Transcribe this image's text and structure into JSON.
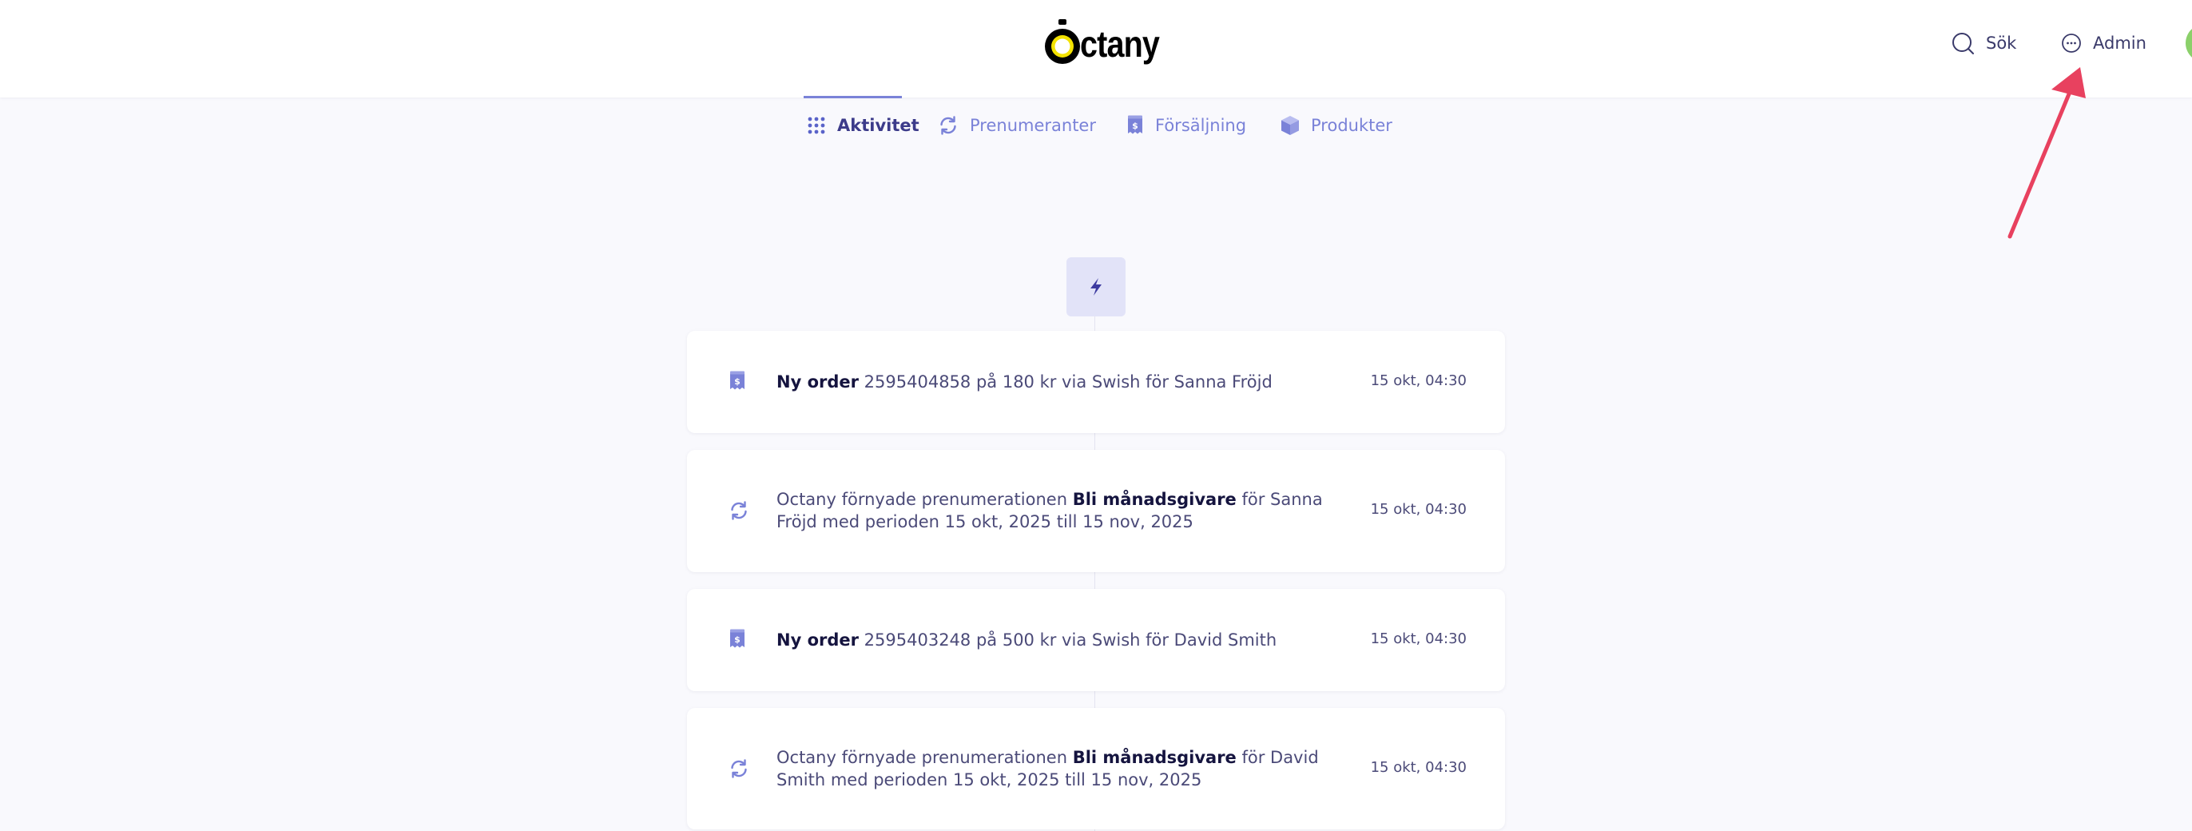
{
  "brand": {
    "name": "ctany",
    "full_name": "Octany"
  },
  "header": {
    "search_label": "Sök",
    "admin_label": "Admin"
  },
  "tabs": [
    {
      "label": "Aktivitet",
      "icon": "grid-icon",
      "active": true
    },
    {
      "label": "Prenumeranter",
      "icon": "refresh-icon",
      "active": false
    },
    {
      "label": "Försäljning",
      "icon": "receipt-icon",
      "active": false
    },
    {
      "label": "Produkter",
      "icon": "box-icon",
      "active": false
    }
  ],
  "feed": {
    "header_icon": "bolt-icon",
    "items": [
      {
        "type": "order",
        "icon": "receipt-icon",
        "prefix": "",
        "bold": "Ny order",
        "suffix": " 2595404858 på 180 kr via Swish för Sanna Fröjd",
        "time": "15 okt, 04:30"
      },
      {
        "type": "renewal",
        "icon": "refresh-icon",
        "prefix": "Octany förnyade prenumerationen ",
        "bold": "Bli månadsgivare",
        "suffix": " för Sanna Fröjd med perioden 15 okt, 2025 till 15 nov, 2025",
        "time": "15 okt, 04:30"
      },
      {
        "type": "order",
        "icon": "receipt-icon",
        "prefix": "",
        "bold": "Ny order",
        "suffix": " 2595403248 på 500 kr via Swish för David Smith",
        "time": "15 okt, 04:30"
      },
      {
        "type": "renewal",
        "icon": "refresh-icon",
        "prefix": "Octany förnyade prenumerationen ",
        "bold": "Bli månadsgivare",
        "suffix": " för David Smith med perioden 15 okt, 2025 till 15 nov, 2025",
        "time": "15 okt, 04:30"
      }
    ]
  },
  "colors": {
    "accent": "#7a82d8",
    "active_tab_text": "#3c3b8a",
    "annotation_arrow": "#e8415f",
    "background": "#f9f9fd"
  }
}
